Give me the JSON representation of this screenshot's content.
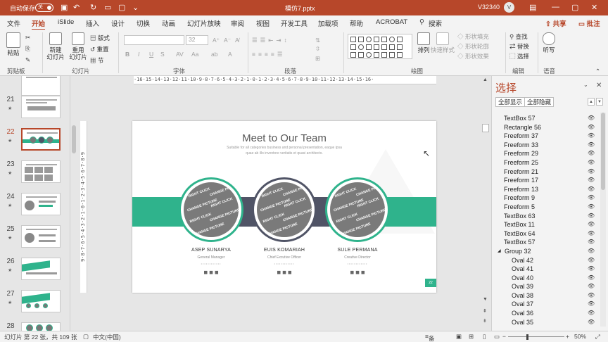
{
  "titlebar": {
    "autosave_label": "自动保存",
    "autosave_state": "关",
    "doc_title": "模仿7.pptx",
    "user": "V32340",
    "avatar": "V",
    "quick": [
      "save-icon",
      "undo-icon",
      "redo-icon",
      "start-from-beginning-icon",
      "open-icon",
      "customize-icon"
    ],
    "wc": [
      "ribbon-options-icon",
      "minimize-icon",
      "restore-icon",
      "close-icon"
    ]
  },
  "menu": {
    "tabs": [
      "文件",
      "开始",
      "iSlide",
      "插入",
      "设计",
      "切换",
      "动画",
      "幻灯片放映",
      "审阅",
      "视图",
      "开发工具",
      "加载项",
      "帮助",
      "ACROBAT"
    ],
    "active": "开始",
    "search": "搜索",
    "share": "共享",
    "comments": "批注"
  },
  "ribbon": {
    "clipboard": {
      "paste": "粘贴",
      "group": "剪贴板"
    },
    "slides": {
      "new_slide": "新建\n幻灯片",
      "reuse": "重用\n幻灯片",
      "layout": "版式",
      "reset": "重置",
      "section": "节",
      "group": "幻灯片"
    },
    "font": {
      "name": "",
      "size": "32",
      "bold": "B",
      "italic": "I",
      "underline": "U",
      "strike": "S",
      "group": "字体"
    },
    "paragraph": {
      "group": "段落"
    },
    "drawing": {
      "arrange": "排列",
      "quick_styles": "快速样式",
      "fill": "形状填充",
      "outline": "形状轮廓",
      "effects": "形状效果",
      "group": "绘图"
    },
    "editing": {
      "find": "查找",
      "replace": "替换",
      "select": "选择",
      "group": "编辑"
    },
    "voice": {
      "dictate": "听写",
      "group": "语音"
    }
  },
  "thumbnails": [
    {
      "num": "21",
      "star": "★",
      "kind": "lines"
    },
    {
      "num": "22",
      "star": "★",
      "kind": "team",
      "selected": true
    },
    {
      "num": "23",
      "star": "★",
      "kind": "grid"
    },
    {
      "num": "24",
      "star": "★",
      "kind": "circle"
    },
    {
      "num": "25",
      "star": "★",
      "kind": "circle"
    },
    {
      "num": "26",
      "star": "★",
      "kind": "slab"
    },
    {
      "num": "27",
      "star": "★",
      "kind": "slab"
    },
    {
      "num": "28",
      "star": "★",
      "kind": "team"
    }
  ],
  "rulers": {
    "horizontal": "·16·15·14·13·12·11·10·9·8·7·6·5·4·3·2·1·0·1·2·3·4·5·6·7·8·9·10·11·12·13·14·15·16·",
    "vertical": "9·8·7·6·5·4·3·2·1·0·1·2·3·4·5·6·7·8·9"
  },
  "slide": {
    "title": "Meet to Our Team",
    "subtitle": "Suitable for all categories business and personal presentation, eaque ipsa quae ab illo inventore veritatis et quasi architecto.",
    "placeholder": [
      "RIGHT CLICK",
      "AND",
      "CHANGE PICTURE"
    ],
    "members": [
      {
        "name": "ASEP SUNARYA",
        "role": "General Manager",
        "dots": "••••••••••••",
        "social": "◼ ◼ ◼"
      },
      {
        "name": "EUIS KOMARIAH",
        "role": "Chief Excutive Officer",
        "dots": "••••••••••••",
        "social": "◼ ◼ ◼"
      },
      {
        "name": "SULE PERMANA",
        "role": "Creative Director",
        "dots": "••••••••••••",
        "social": "◼ ◼ ◼"
      }
    ],
    "page_number": "22"
  },
  "selection_pane": {
    "title": "选择",
    "show_all": "全部显示",
    "hide_all": "全部隐藏",
    "items": [
      {
        "label": "TextBox 57",
        "indent": 0
      },
      {
        "label": "Rectangle 56",
        "indent": 0
      },
      {
        "label": "Freeform 37",
        "indent": 0
      },
      {
        "label": "Freeform 33",
        "indent": 0
      },
      {
        "label": "Freeform 29",
        "indent": 0
      },
      {
        "label": "Freeform 25",
        "indent": 0
      },
      {
        "label": "Freeform 21",
        "indent": 0
      },
      {
        "label": "Freeform 17",
        "indent": 0
      },
      {
        "label": "Freeform 13",
        "indent": 0
      },
      {
        "label": "Freeform 9",
        "indent": 0
      },
      {
        "label": "Freeform 5",
        "indent": 0
      },
      {
        "label": "TextBox 63",
        "indent": 0
      },
      {
        "label": "TextBox 11",
        "indent": 0
      },
      {
        "label": "TextBox 64",
        "indent": 0
      },
      {
        "label": "TextBox 57",
        "indent": 0
      },
      {
        "label": "Group 32",
        "indent": 0,
        "group": true
      },
      {
        "label": "Oval 42",
        "indent": 1
      },
      {
        "label": "Oval 41",
        "indent": 1
      },
      {
        "label": "Oval 40",
        "indent": 1
      },
      {
        "label": "Oval 39",
        "indent": 1
      },
      {
        "label": "Oval 38",
        "indent": 1
      },
      {
        "label": "Oval 37",
        "indent": 1
      },
      {
        "label": "Oval 36",
        "indent": 1
      },
      {
        "label": "Oval 35",
        "indent": 1
      }
    ]
  },
  "status": {
    "slide_info": "幻灯片 第 22 张，共 109 张",
    "language": "中文(中国)",
    "notes": "备注",
    "zoom": "50%"
  },
  "colors": {
    "accent": "#b7472a",
    "teal": "#2fb38c",
    "slate": "#505466"
  }
}
